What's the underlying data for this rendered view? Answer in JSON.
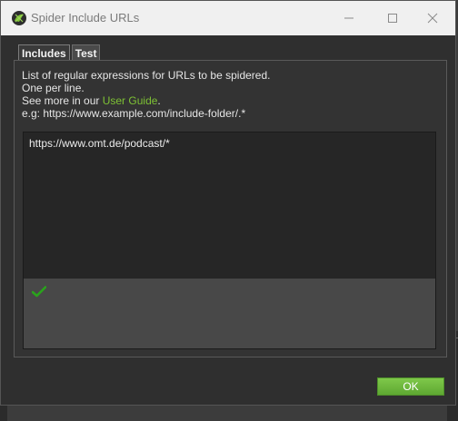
{
  "window": {
    "title": "Spider Include URLs"
  },
  "tabs": [
    {
      "label": "Includes",
      "active": true
    },
    {
      "label": "Test",
      "active": false
    }
  ],
  "description": {
    "line1": "List of regular expressions for URLs to be spidered.",
    "line2": "One per line.",
    "line3_prefix": "See more in our ",
    "line3_link": "User Guide",
    "line3_suffix": ".",
    "line4": "e.g: https://www.example.com/include-folder/.*"
  },
  "editor": {
    "value": "https://www.omt.de/podcast/*"
  },
  "validation": {
    "icon": "check-icon",
    "color": "#2aa31c"
  },
  "buttons": {
    "ok_label": "OK"
  },
  "background": {
    "fragment": "a"
  },
  "colors": {
    "accent": "#7ec234",
    "ok_button": "#6bb83b"
  }
}
